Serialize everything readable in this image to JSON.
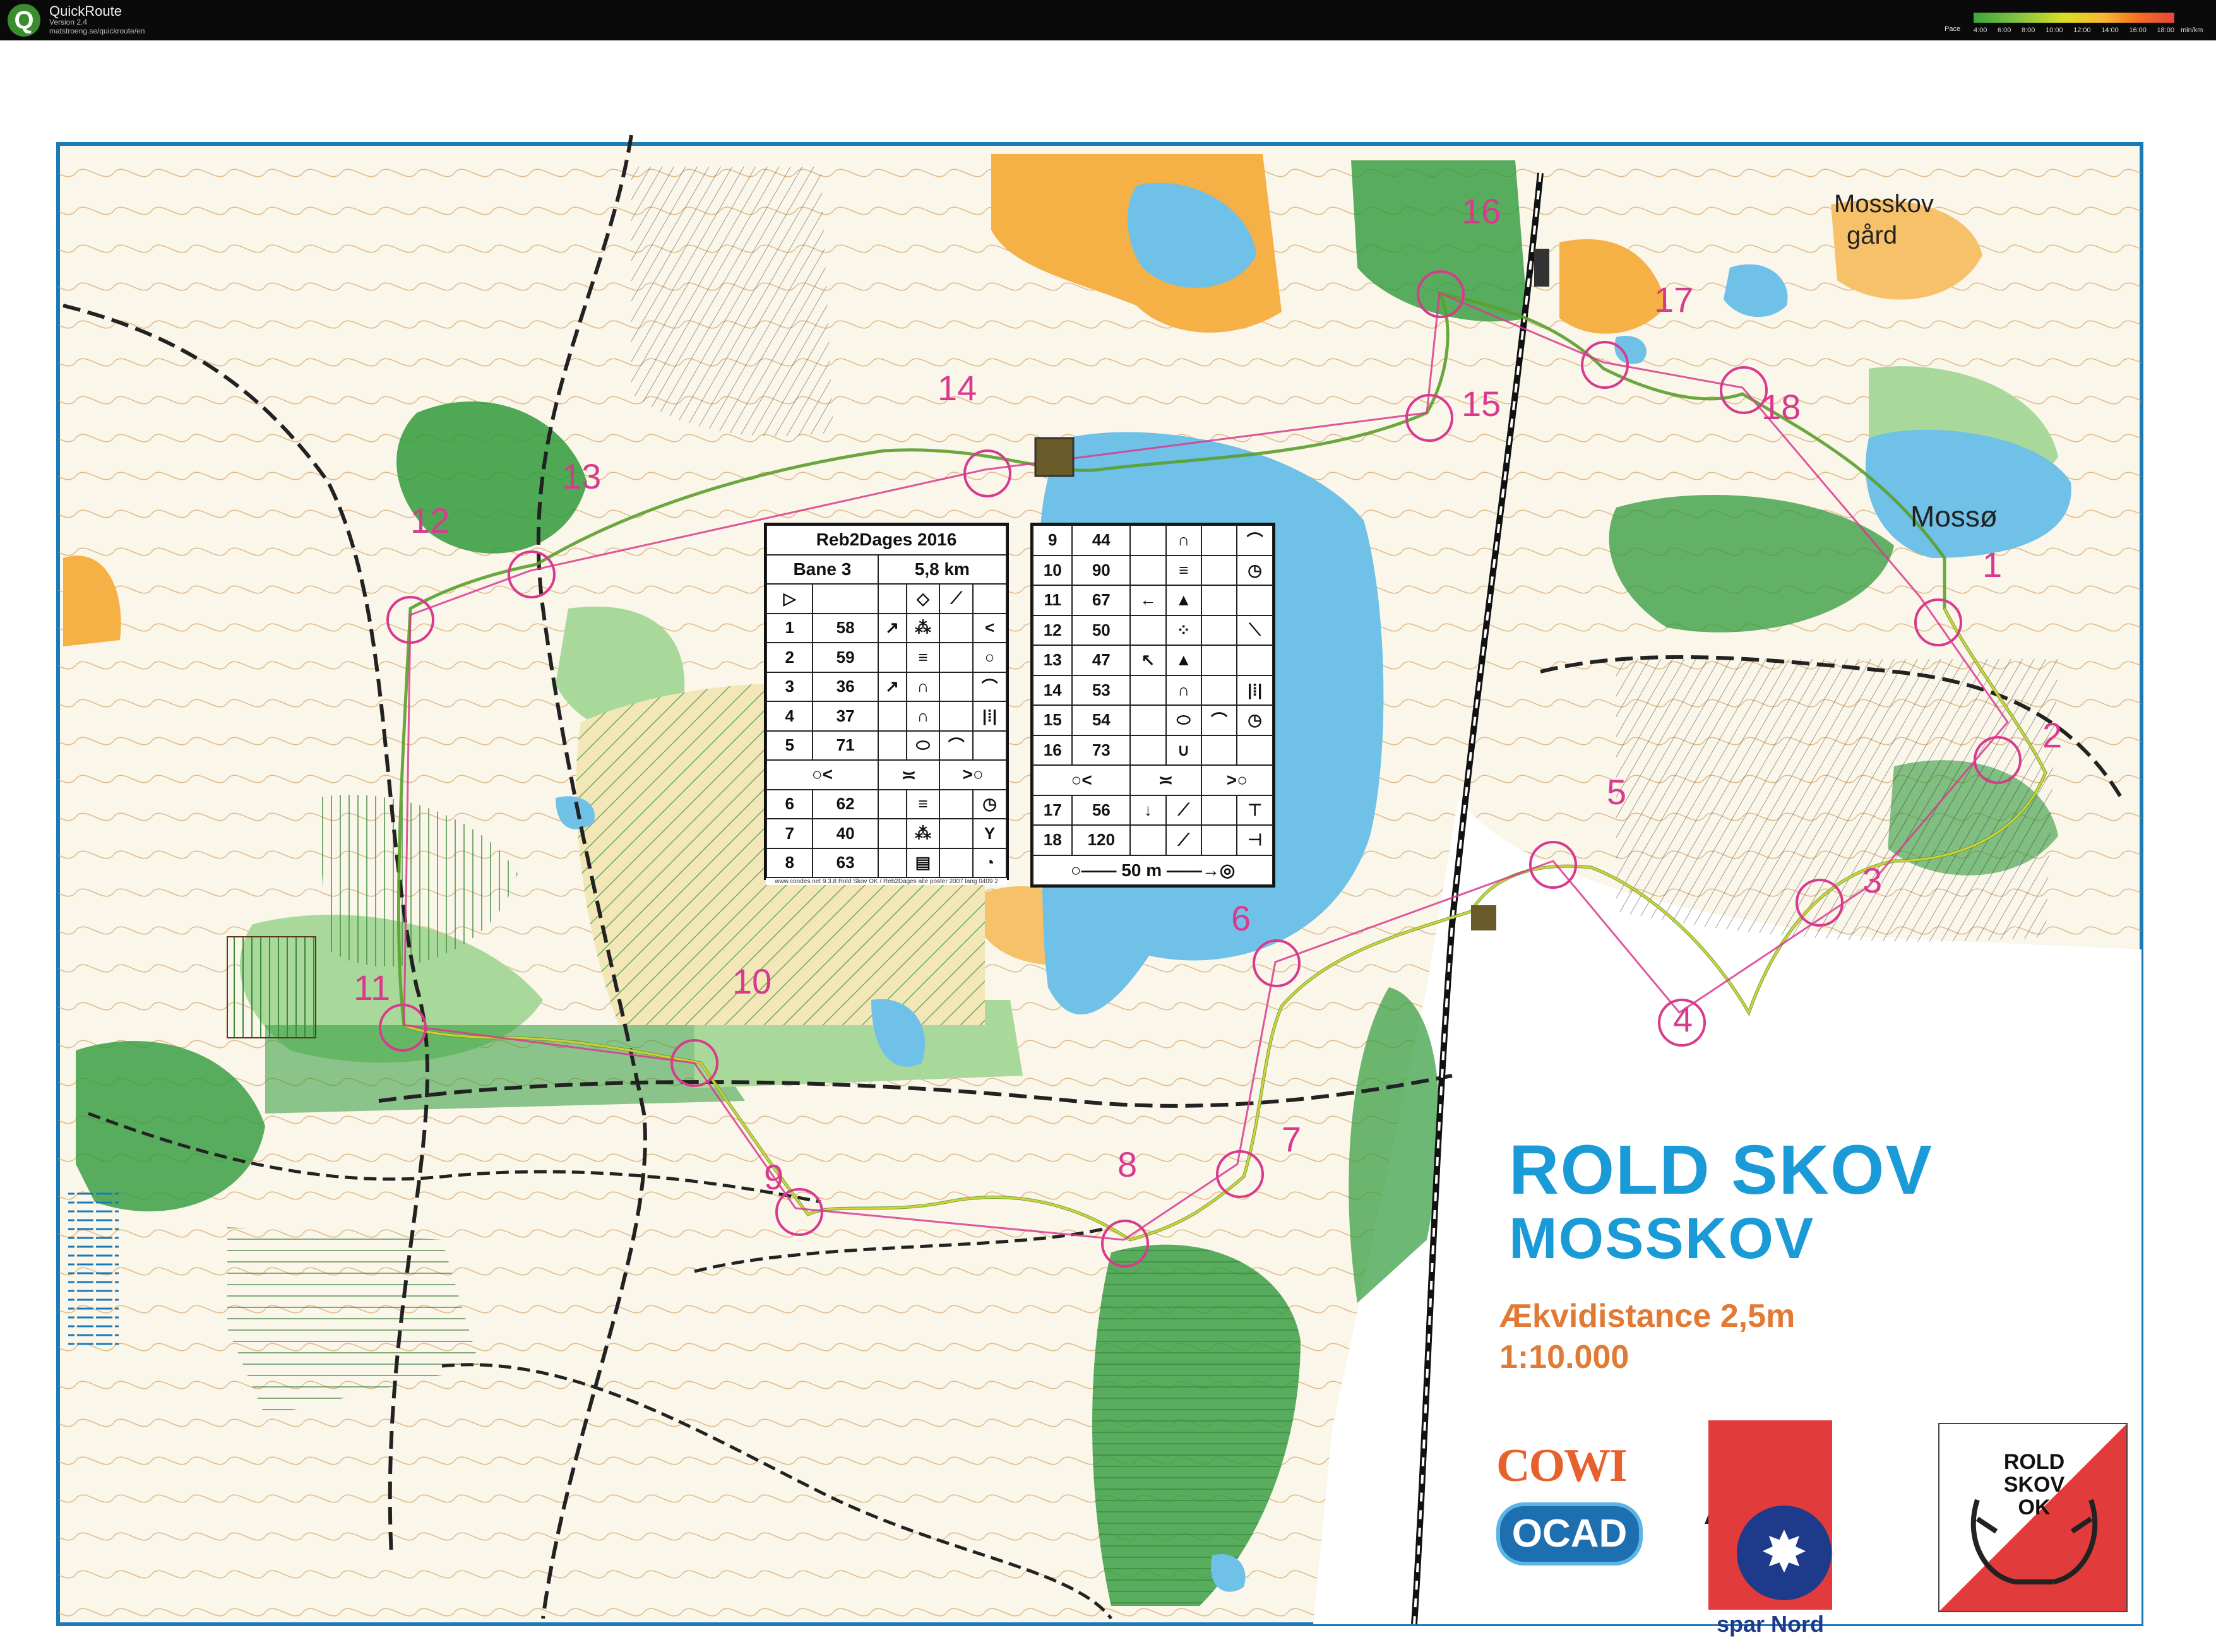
{
  "app": {
    "name": "QuickRoute",
    "version": "Version 2.4",
    "url": "matstroeng.se/quickroute/en",
    "icon": "quickroute-logo"
  },
  "pace_legend": {
    "title": "Pace",
    "ticks": [
      "4:00",
      "6:00",
      "8:00",
      "10:00",
      "12:00",
      "14:00",
      "16:00",
      "18:00"
    ],
    "unit": "min/km"
  },
  "map": {
    "title": "ROLD SKOV",
    "subtitle": "MOSSKOV",
    "contour_interval": "Ækvidistance 2,5m",
    "scale": "1:10.000",
    "place_names": [
      "Mosskov",
      "gård",
      "Mossø"
    ],
    "colors": {
      "water": "#6fc1e8",
      "open_land": "#f5b046",
      "green": "#2f9a3a",
      "light_green": "#a8d99a",
      "course": "#d83a8e",
      "route": "#5aa02c",
      "title": "#1a9ad6",
      "info_text": "#e07a35"
    },
    "controls": [
      {
        "label": "1"
      },
      {
        "label": "2"
      },
      {
        "label": "3"
      },
      {
        "label": "4"
      },
      {
        "label": "5"
      },
      {
        "label": "6"
      },
      {
        "label": "7"
      },
      {
        "label": "8"
      },
      {
        "label": "9"
      },
      {
        "label": "10"
      },
      {
        "label": "11"
      },
      {
        "label": "12"
      },
      {
        "label": "13"
      },
      {
        "label": "14"
      },
      {
        "label": "15"
      },
      {
        "label": "16"
      },
      {
        "label": "17"
      },
      {
        "label": "18"
      }
    ]
  },
  "control_descriptions": {
    "event": "Reb2Dages 2016",
    "course": "Bane 3",
    "length": "5,8 km",
    "left": [
      {
        "no": "1",
        "code": "58"
      },
      {
        "no": "2",
        "code": "59"
      },
      {
        "no": "3",
        "code": "36"
      },
      {
        "no": "4",
        "code": "37"
      },
      {
        "no": "5",
        "code": "71"
      },
      {
        "no": "6",
        "code": "62"
      },
      {
        "no": "7",
        "code": "40"
      },
      {
        "no": "8",
        "code": "63"
      }
    ],
    "right": [
      {
        "no": "9",
        "code": "44"
      },
      {
        "no": "10",
        "code": "90"
      },
      {
        "no": "11",
        "code": "67"
      },
      {
        "no": "12",
        "code": "50"
      },
      {
        "no": "13",
        "code": "47"
      },
      {
        "no": "14",
        "code": "53"
      },
      {
        "no": "15",
        "code": "54"
      },
      {
        "no": "16",
        "code": "73"
      },
      {
        "no": "17",
        "code": "56"
      },
      {
        "no": "18",
        "code": "120"
      }
    ],
    "finish": "50 m",
    "footer": "www.condes.net 9.3.8 Rold Skov OK / Reb2Dages alle poster 2007 lang 0409 2"
  },
  "logos": {
    "cowi": "COWI",
    "ocad": "OCAD",
    "spar_nord": "spar Nord",
    "rold_skov_ok": [
      "ROLD",
      "SKOV",
      "OK"
    ]
  }
}
